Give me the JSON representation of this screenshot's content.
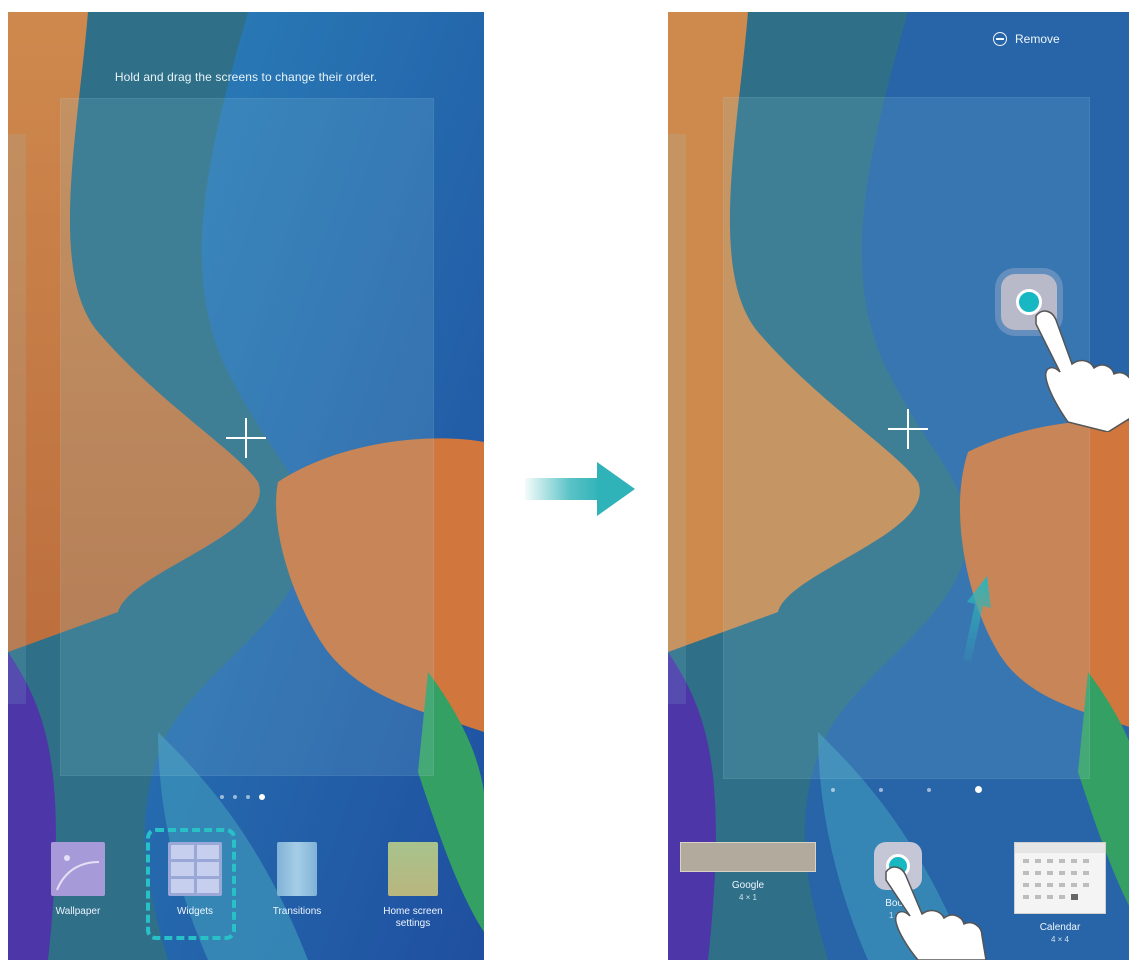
{
  "left_screen": {
    "hint": "Hold and drag the screens to change their order.",
    "menu": [
      {
        "label": "Wallpaper",
        "icon": "wallpaper-icon"
      },
      {
        "label": "Widgets",
        "icon": "widgets-icon"
      },
      {
        "label": "Transitions",
        "icon": "transitions-icon"
      },
      {
        "label": "Home screen settings",
        "icon": "home-screen-settings-icon"
      }
    ],
    "page_count": 4,
    "active_page": 4
  },
  "right_screen": {
    "remove_label": "Remove",
    "widgets": [
      {
        "label": "Google",
        "sub": "4 × 1",
        "icon": "google-widget-preview"
      },
      {
        "label": "Boost",
        "sub": "1 × 1",
        "icon": "boost-widget-icon"
      },
      {
        "label": "Calendar",
        "sub": "4 × 4",
        "icon": "calendar-widget-preview"
      }
    ],
    "page_count": 4,
    "active_page": 4
  },
  "colors": {
    "highlight": "#27c1c7",
    "arrow": "#2fb3b8",
    "accent_ring": "#18b8c2"
  }
}
